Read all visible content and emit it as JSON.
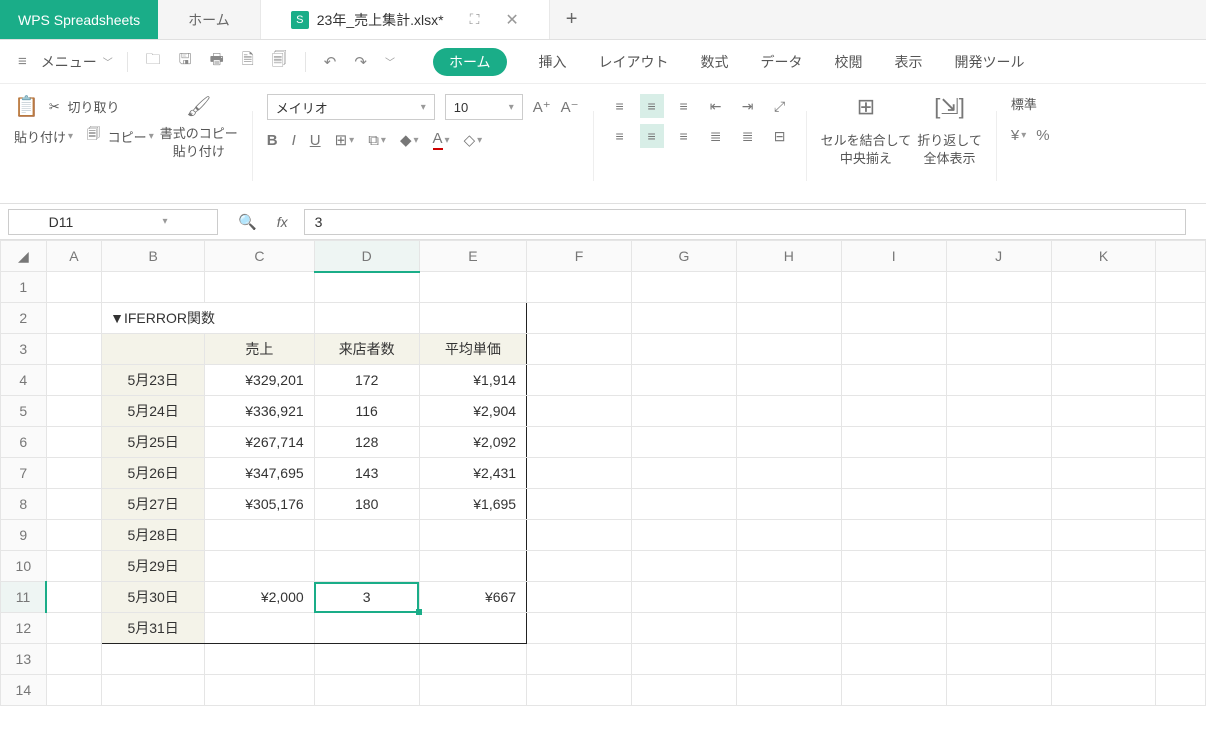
{
  "app": {
    "name": "WPS Spreadsheets"
  },
  "tabs": {
    "home": "ホーム",
    "file": {
      "name": "23年_売上集計.xlsx*",
      "badge": "S"
    },
    "add": "+"
  },
  "menubar": {
    "menu_label": "メニュー",
    "ribbon_tabs": [
      "ホーム",
      "挿入",
      "レイアウト",
      "数式",
      "データ",
      "校閲",
      "表示",
      "開発ツール"
    ]
  },
  "ribbon": {
    "cut": "切り取り",
    "paste": "貼り付け",
    "copy": "コピー",
    "format_painter": "書式のコピー\n貼り付け",
    "font_name": "メイリオ",
    "font_size": "10",
    "merge": "セルを結合して\n中央揃え",
    "wrap": "折り返して\n全体表示",
    "style_label": "標準",
    "currency": "¥",
    "percent": "%"
  },
  "namebox": {
    "ref": "D11",
    "formula": "3",
    "fx": "fx"
  },
  "sheet": {
    "cols": [
      "A",
      "B",
      "C",
      "D",
      "E",
      "F",
      "G",
      "H",
      "I",
      "J",
      "K",
      ""
    ],
    "rows": [
      "1",
      "2",
      "3",
      "4",
      "5",
      "6",
      "7",
      "8",
      "9",
      "10",
      "11",
      "12",
      "13",
      "14"
    ],
    "title": "▼IFERROR関数",
    "hdr": {
      "c": "売上",
      "d": "来店者数",
      "e": "平均単価"
    },
    "data": [
      {
        "b": "5月23日",
        "c": "¥329,201",
        "d": "172",
        "e": "¥1,914"
      },
      {
        "b": "5月24日",
        "c": "¥336,921",
        "d": "116",
        "e": "¥2,904"
      },
      {
        "b": "5月25日",
        "c": "¥267,714",
        "d": "128",
        "e": "¥2,092"
      },
      {
        "b": "5月26日",
        "c": "¥347,695",
        "d": "143",
        "e": "¥2,431"
      },
      {
        "b": "5月27日",
        "c": "¥305,176",
        "d": "180",
        "e": "¥1,695"
      },
      {
        "b": "5月28日",
        "c": "",
        "d": "",
        "e": ""
      },
      {
        "b": "5月29日",
        "c": "",
        "d": "",
        "e": ""
      },
      {
        "b": "5月30日",
        "c": "¥2,000",
        "d": "3",
        "e": "¥667"
      },
      {
        "b": "5月31日",
        "c": "",
        "d": "",
        "e": ""
      }
    ]
  }
}
